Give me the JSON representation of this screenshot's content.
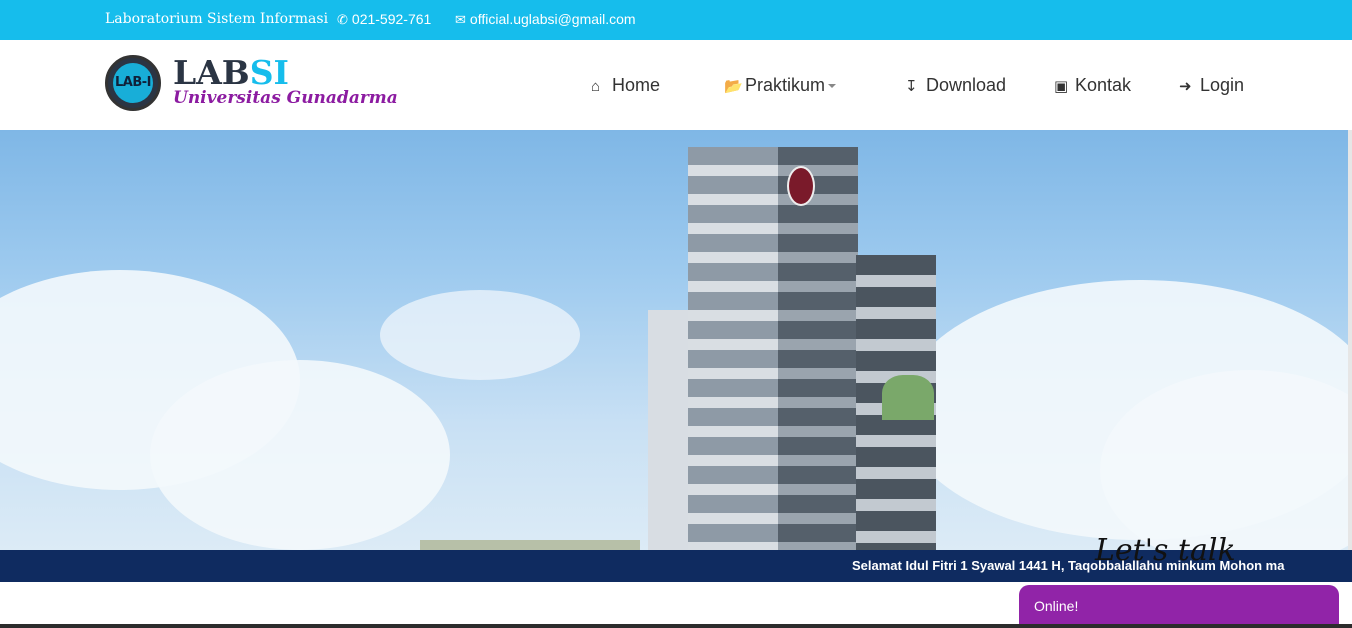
{
  "topbar": {
    "site_name": "Laboratorium Sistem Informasi",
    "phone": "021-592-761",
    "email": "official.uglabsi@gmail.com",
    "background_color": "#16bdec",
    "phone_icon": "phone-icon",
    "email_icon": "envelope-icon"
  },
  "header": {
    "logo_text": "LAB-I",
    "brand_main": "LAB",
    "brand_accent": "SI",
    "tagline": "Universitas Gunadarma",
    "tagline_color": "#8c1ba1"
  },
  "nav": {
    "home": "Home",
    "praktikum": "Praktikum",
    "download": "Download",
    "kontak": "Kontak",
    "login": "Login"
  },
  "ticker": {
    "text": "Selamat Idul Fitri 1 Syawal 1441 H, Taqobbalallahu minkum Mohon ma",
    "background_color": "#0f2b60"
  },
  "chat": {
    "greeting": "Let's talk",
    "status": "Online!",
    "color": "#9124a8"
  }
}
